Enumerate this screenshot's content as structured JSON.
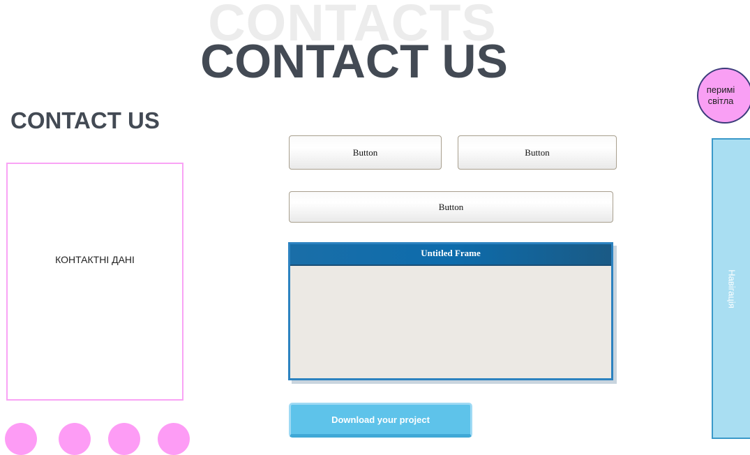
{
  "header": {
    "background_title": "CONTACTS",
    "main_title": "CONTACT US"
  },
  "left_panel": {
    "title": "CONTACT US",
    "contact_box_label": "КОНТАКТНІ ДАНІ",
    "dots": [
      {
        "color": "#fd9cf5"
      },
      {
        "color": "#fd9cf5"
      },
      {
        "color": "#fd9cf5"
      },
      {
        "color": "#fd9cf5"
      }
    ]
  },
  "buttons": {
    "button_1_label": "Button",
    "button_2_label": "Button",
    "button_3_label": "Button"
  },
  "frame": {
    "title": "Untitled Frame"
  },
  "download": {
    "label": "Download your project"
  },
  "light_switch": {
    "line1": "перимі",
    "line2": "світла"
  },
  "navigation": {
    "label": "Навігація"
  },
  "colors": {
    "title_dark": "#434a54",
    "accent_pink": "#fd9cf5",
    "accent_blue": "#5ec3ea",
    "frame_blue": "#0d6cac",
    "nav_blue": "#a9def2"
  }
}
